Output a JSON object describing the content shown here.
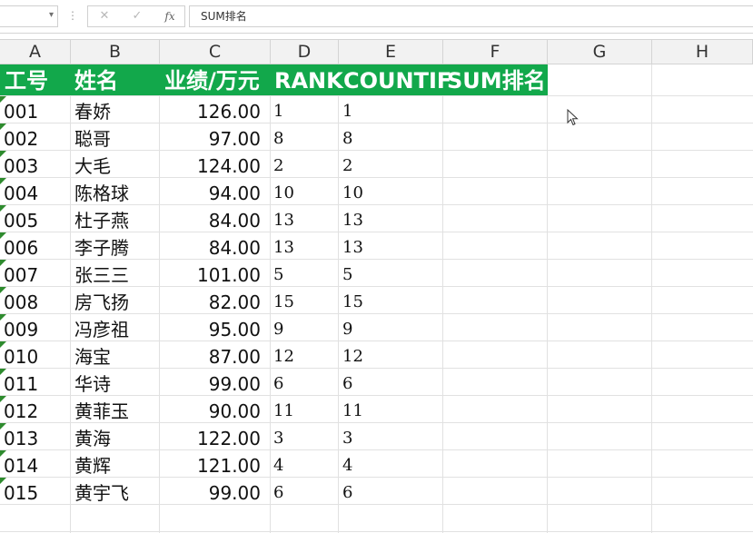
{
  "formula_bar": {
    "name_box_value": "",
    "dropdown_glyph": "▾",
    "separator_glyph": "⋮",
    "cancel_glyph": "✕",
    "confirm_glyph": "✓",
    "fx_glyph": "fx",
    "formula_value": "SUM排名"
  },
  "columns": [
    "A",
    "B",
    "C",
    "D",
    "E",
    "F",
    "G",
    "H"
  ],
  "header": [
    "工号",
    "姓名",
    "业绩/万元",
    "RANK",
    "COUNTIF",
    "SUM排名"
  ],
  "rows": [
    {
      "id": "001",
      "name": "春娇",
      "perf": "126.00",
      "rank": "1",
      "countif": "1"
    },
    {
      "id": "002",
      "name": "聪哥",
      "perf": "97.00",
      "rank": "8",
      "countif": "8"
    },
    {
      "id": "003",
      "name": "大毛",
      "perf": "124.00",
      "rank": "2",
      "countif": "2"
    },
    {
      "id": "004",
      "name": "陈格球",
      "perf": "94.00",
      "rank": "10",
      "countif": "10"
    },
    {
      "id": "005",
      "name": "杜子燕",
      "perf": "84.00",
      "rank": "13",
      "countif": "13"
    },
    {
      "id": "006",
      "name": "李子腾",
      "perf": "84.00",
      "rank": "13",
      "countif": "13"
    },
    {
      "id": "007",
      "name": "张三三",
      "perf": "101.00",
      "rank": "5",
      "countif": "5"
    },
    {
      "id": "008",
      "name": "房飞扬",
      "perf": "82.00",
      "rank": "15",
      "countif": "15"
    },
    {
      "id": "009",
      "name": "冯彦祖",
      "perf": "95.00",
      "rank": "9",
      "countif": "9"
    },
    {
      "id": "010",
      "name": "海宝",
      "perf": "87.00",
      "rank": "12",
      "countif": "12"
    },
    {
      "id": "011",
      "name": "华诗",
      "perf": "99.00",
      "rank": "6",
      "countif": "6"
    },
    {
      "id": "012",
      "name": "黄菲玉",
      "perf": "90.00",
      "rank": "11",
      "countif": "11"
    },
    {
      "id": "013",
      "name": "黄海",
      "perf": "122.00",
      "rank": "3",
      "countif": "3"
    },
    {
      "id": "014",
      "name": "黄辉",
      "perf": "121.00",
      "rank": "4",
      "countif": "4"
    },
    {
      "id": "015",
      "name": "黄宇飞",
      "perf": "99.00",
      "rank": "6",
      "countif": "6"
    }
  ],
  "colors": {
    "header_fill": "#12a84b",
    "header_text": "#ffffff",
    "error_indicator": "#2e8b2e",
    "gridline": "#e1e1e1"
  }
}
